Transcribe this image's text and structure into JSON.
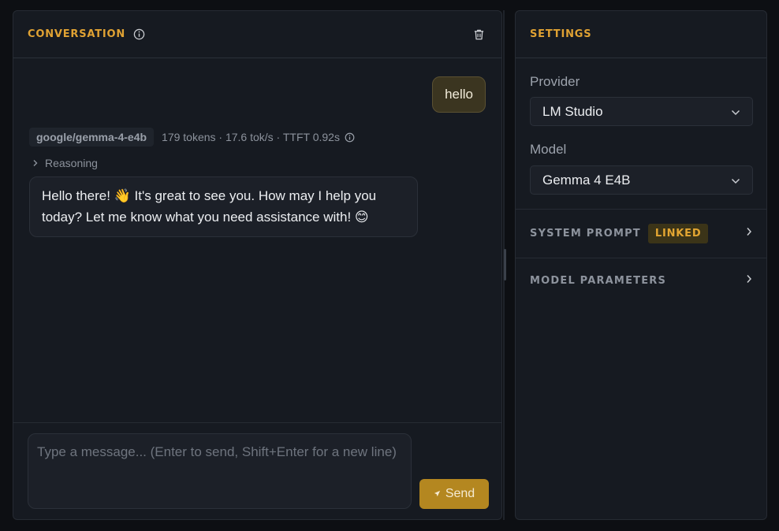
{
  "conversation": {
    "title": "CONVERSATION",
    "user_message": "hello",
    "assistant": {
      "model": "google/gemma-4-e4b",
      "stats": "179 tokens · 17.6 tok/s · TTFT 0.92s",
      "reasoning_label": "Reasoning",
      "message": "Hello there! 👋 It's great to see you. How may I help you today? Let me know what you need assistance with! 😊"
    },
    "composer": {
      "placeholder": "Type a message... (Enter to send, Shift+Enter for a new line)",
      "value": "",
      "send_label": "Send"
    }
  },
  "settings": {
    "title": "SETTINGS",
    "provider_label": "Provider",
    "provider_value": "LM Studio",
    "model_label": "Model",
    "model_value": "Gemma 4 E4B",
    "system_prompt_label": "SYSTEM PROMPT",
    "system_prompt_badge": "LINKED",
    "model_parameters_label": "MODEL PARAMETERS"
  },
  "colors": {
    "accent": "#e0a233",
    "send_button": "#b48720",
    "background": "#0d0f13",
    "panel": "#161a21"
  }
}
